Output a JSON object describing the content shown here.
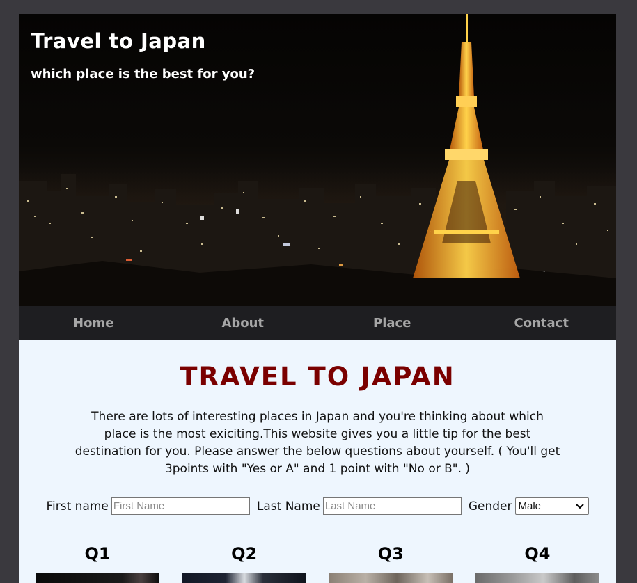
{
  "hero": {
    "title": "Travel to Japan",
    "subtitle": "which place is the best for you?"
  },
  "nav": {
    "items": [
      {
        "label": "Home"
      },
      {
        "label": "About"
      },
      {
        "label": "Place"
      },
      {
        "label": "Contact"
      }
    ]
  },
  "main": {
    "title": "TRAVEL TO JAPAN",
    "intro": "There are lots of interesting places in Japan and you're thinking about which place is the most exiciting.This website gives you a little tip for the best destination for you. Please answer the below questions about yourself. ( You'll get 3points with \"Yes or A\" and 1 point with \"No or B\". )"
  },
  "form": {
    "first_name_label": "First name",
    "first_name_placeholder": "First Name",
    "last_name_label": "Last Name",
    "last_name_placeholder": "Last Name",
    "gender_label": "Gender",
    "gender_value": "Male"
  },
  "questions": [
    {
      "label": "Q1"
    },
    {
      "label": "Q2"
    },
    {
      "label": "Q3"
    },
    {
      "label": "Q4"
    }
  ],
  "colors": {
    "title": "#7a0000",
    "nav_bg": "#1e1e21",
    "content_bg": "#eef6fe"
  }
}
